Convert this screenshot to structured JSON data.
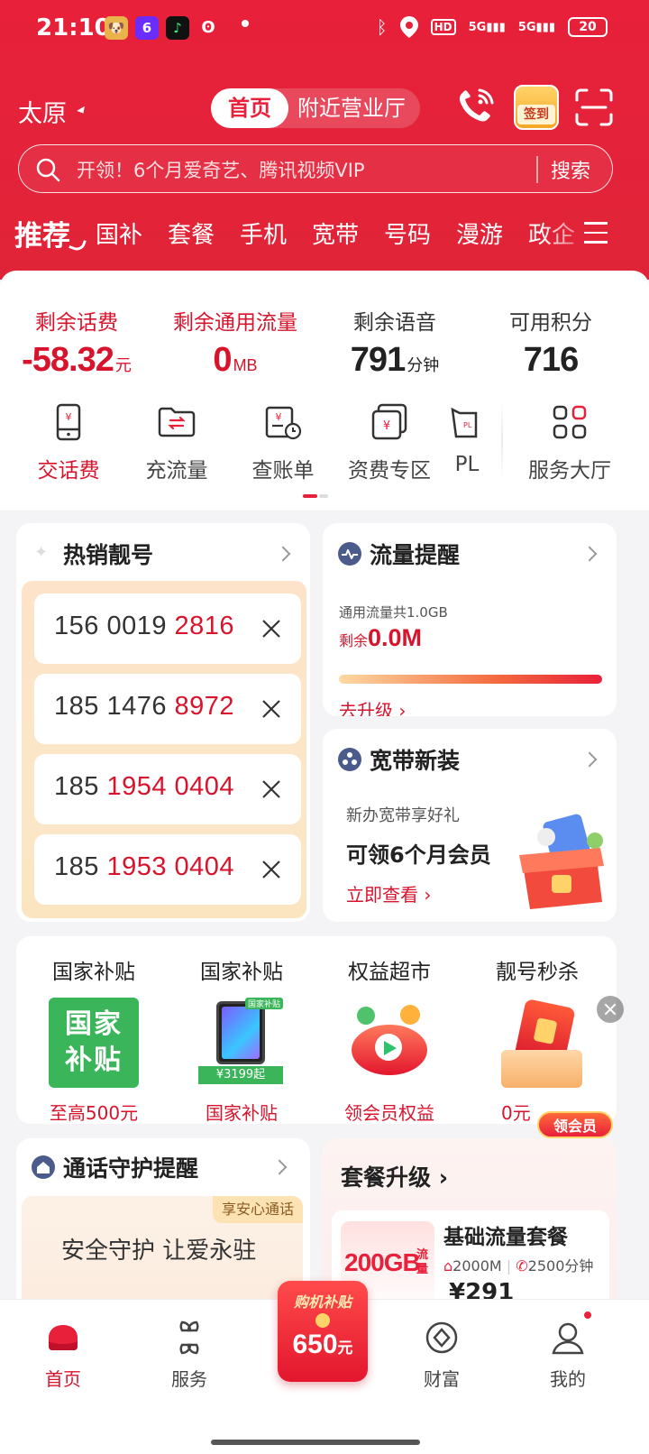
{
  "status_bar": {
    "time": "21:10",
    "battery": "20",
    "network": "5G"
  },
  "header": {
    "city": "太原",
    "seg_active": "首页",
    "seg_inactive": "附近营业厅",
    "search_placeholder": "开领！6个月爱奇艺、腾讯视频VIP",
    "search_button": "搜索",
    "signin_label": "签到",
    "nav": [
      "推荐",
      "国补",
      "套餐",
      "手机",
      "宽带",
      "号码",
      "漫游",
      "政企"
    ]
  },
  "stats": [
    {
      "label": "剩余话费",
      "value": "-58.32",
      "unit": "元"
    },
    {
      "label": "剩余通用流量",
      "value": "0",
      "unit": "MB"
    },
    {
      "label": "剩余语音",
      "value": "791",
      "unit": "分钟"
    },
    {
      "label": "可用积分",
      "value": "716",
      "unit": ""
    }
  ],
  "services": [
    "交话费",
    "充流量",
    "查账单",
    "资费专区",
    "PL",
    "服务大厅"
  ],
  "hot_numbers": {
    "title": "热销靓号",
    "items": [
      {
        "prefix": "156 0019 ",
        "highlight": "2816"
      },
      {
        "prefix": "185 1476 ",
        "highlight": "8972"
      },
      {
        "prefix": "185 ",
        "highlight": "1954 0404"
      },
      {
        "prefix": "185 ",
        "highlight": "1953 0404"
      }
    ]
  },
  "flow_alert": {
    "title": "流量提醒",
    "total": "通用流量共1.0GB",
    "remain_label": "剩余",
    "remain_value": "0.0M",
    "link": "去升级",
    "used_fraction": 1.0
  },
  "broadband": {
    "title": "宽带新装",
    "subtitle": "新办宽带享好礼",
    "headline": "可领6个月会员",
    "link": "立即查看"
  },
  "subsidy": [
    {
      "title": "国家补贴",
      "caption": "至高500元",
      "img_text": "国家补贴"
    },
    {
      "title": "国家补贴",
      "caption": "国家补贴",
      "img_price": "¥3199起",
      "img_tag": "国家补贴"
    },
    {
      "title": "权益超市",
      "caption": "领会员权益"
    },
    {
      "title": "靓号秒杀",
      "caption": "0元"
    }
  ],
  "vip_badge": "领会员",
  "call_guard": {
    "title": "通话守护提醒",
    "tag": "享安心通话",
    "text": "安全守护 让爱永驻"
  },
  "package": {
    "title": "套餐升级",
    "name": "基础流量套餐",
    "big": "200GB",
    "big_unit": "流量",
    "spec_speed": "2000M",
    "spec_voice": "2500分钟",
    "price": "¥291"
  },
  "tabbar": {
    "items": [
      "首页",
      "服务",
      "财富",
      "我的"
    ],
    "promo_top": "购机补贴",
    "promo_num": "650",
    "promo_unit": "元"
  },
  "colors": {
    "brand": "#e8203a",
    "text_red": "#d8142d"
  }
}
